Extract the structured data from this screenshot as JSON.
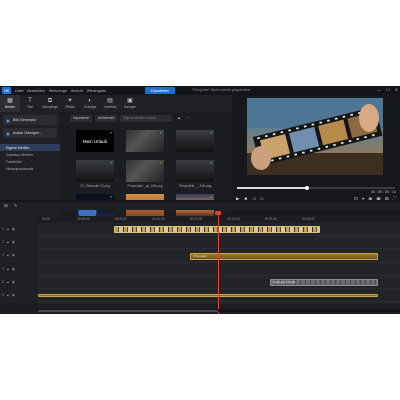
{
  "app": {
    "logo": "≡K",
    "project_title": "\"Filmjunke\" Nicht zuletzt gespeichert",
    "export_label": "Exportieren",
    "window_buttons": [
      "—",
      "☐",
      "✕"
    ]
  },
  "menu": [
    "Datei",
    "Bearbeiten",
    "Werkzeuge",
    "Ansicht",
    "Wiedergabe"
  ],
  "toolbar": [
    {
      "label": "Medien",
      "icon": "▦",
      "active": true
    },
    {
      "label": "Titel",
      "icon": "T"
    },
    {
      "label": "Übergänge",
      "icon": "⧉"
    },
    {
      "label": "Effekte",
      "icon": "✦"
    },
    {
      "label": "Overlays",
      "icon": "◐"
    },
    {
      "label": "Untertitel",
      "icon": "▤"
    },
    {
      "label": "Vorlagen",
      "icon": "▣"
    }
  ],
  "sidebar": {
    "button1": "Bild Generator",
    "button2": "Avatar Videogen...",
    "items": [
      "Eigene Medien",
      "Gametoo Medien",
      "Farbfelder",
      "Hintergrundmusik"
    ]
  },
  "media": {
    "import_label": "Importieren",
    "record_label": "Aufnehmen",
    "search_placeholder": "Eigene Medien suchen",
    "items": [
      {
        "label": "",
        "title_text": "Mein Urlaub",
        "style": "title"
      },
      {
        "label": "",
        "style": "film"
      },
      {
        "label": "",
        "style": "dark"
      },
      {
        "label": "CV_Rekorder 03.png",
        "style": "dark"
      },
      {
        "label": "Filmprojekt _up_045.png",
        "style": "film"
      },
      {
        "label": "Filmprojekt _ _Edit.png",
        "style": "dark"
      },
      {
        "label": "",
        "style": "earth"
      },
      {
        "label": "",
        "style": "desert"
      },
      {
        "label": "",
        "style": "sunset"
      }
    ]
  },
  "preview": {
    "progress": 0.44,
    "timecode": "00 : 00 : 00 : 14",
    "controls": [
      "▶",
      "■",
      "◁",
      "▷"
    ],
    "right_controls": [
      "⊡",
      "⌖",
      "◉",
      "▣",
      "▤",
      "⛶"
    ],
    "tooltip": "Wieder. Splitten"
  },
  "timeline": {
    "bar_icons": [
      "⊞",
      "✎"
    ],
    "ticks": [
      "00:00",
      "00:00:00",
      "00:00:20",
      "00:00:40",
      "00:01:00",
      "00:01:20",
      "00:01:40",
      "00:02:00"
    ],
    "tracks": [
      {
        "index": "1",
        "clips": [
          {
            "name": "",
            "type": "video",
            "start": 0.21,
            "end": 0.78
          }
        ]
      },
      {
        "index": "2",
        "clips": []
      },
      {
        "index": "3",
        "clips": [
          {
            "name": "Filmprojekt",
            "type": "gold",
            "start": 0.42,
            "end": 0.94
          }
        ]
      },
      {
        "index": "4",
        "clips": []
      },
      {
        "index": "5",
        "clips": [
          {
            "name": "Hintergrund Musik",
            "type": "gray",
            "start": 0.64,
            "end": 0.94
          }
        ]
      },
      {
        "index": "6",
        "clips": [
          {
            "name": "",
            "type": "gold",
            "start": 0.0,
            "end": 0.94
          }
        ]
      }
    ]
  }
}
